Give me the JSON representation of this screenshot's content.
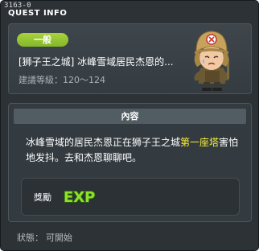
{
  "window": {
    "id": "3163-0",
    "title": "QUEST INFO"
  },
  "quest": {
    "category": "一般",
    "name": "[狮子王之城] 冰峰雪域居民杰恩的...",
    "level_text": "建議等級：120～124"
  },
  "content": {
    "header": "內容",
    "text_before": "冰峰雪域的居民杰恩正在狮子王之城",
    "text_highlight": "第一座塔",
    "text_after": "害怕地发抖。去和杰恩聊聊吧。",
    "highlight_color": "#f7ef3a"
  },
  "reward": {
    "label": "獎勵",
    "exp_label": "EXP",
    "exp_color": "#7fd31f"
  },
  "status": {
    "label": "狀態：",
    "value": "可開始"
  },
  "colors": {
    "window_bg": "#2c3236",
    "badge_green": "#94c52f"
  },
  "icons": {
    "npc": "npc-portrait-icon",
    "exp": "exp-icon"
  }
}
